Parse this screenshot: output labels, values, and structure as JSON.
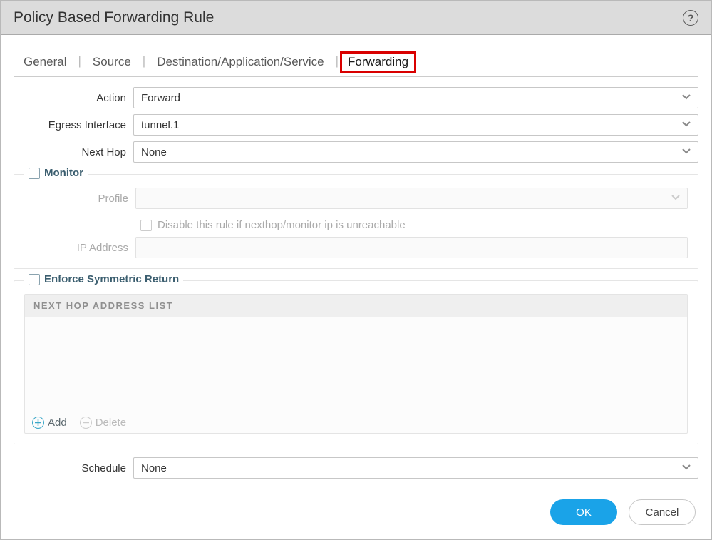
{
  "title": "Policy Based Forwarding Rule",
  "tabs": {
    "general": "General",
    "source": "Source",
    "dest": "Destination/Application/Service",
    "forwarding": "Forwarding"
  },
  "fields": {
    "action_label": "Action",
    "action_value": "Forward",
    "egress_label": "Egress Interface",
    "egress_value": "tunnel.1",
    "nexthop_label": "Next Hop",
    "nexthop_value": "None",
    "schedule_label": "Schedule",
    "schedule_value": "None"
  },
  "monitor": {
    "legend": "Monitor",
    "profile_label": "Profile",
    "profile_value": "",
    "disable_label": "Disable this rule if nexthop/monitor ip is unreachable",
    "ip_label": "IP Address",
    "ip_value": ""
  },
  "symmetric": {
    "legend": "Enforce Symmetric Return",
    "list_header": "NEXT HOP ADDRESS LIST",
    "add_label": "Add",
    "delete_label": "Delete"
  },
  "buttons": {
    "ok": "OK",
    "cancel": "Cancel"
  }
}
